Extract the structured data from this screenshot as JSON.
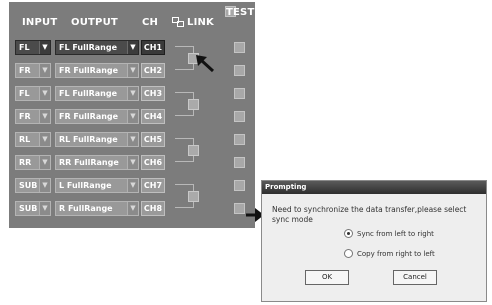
{
  "headers": {
    "input": "INPUT",
    "output": "OUTPUT",
    "ch": "CH",
    "link": "LINK",
    "test": "TEST"
  },
  "rows": [
    {
      "input": "FL",
      "output": "FL FullRange",
      "ch": "CH1"
    },
    {
      "input": "FR",
      "output": "FR FullRange",
      "ch": "CH2"
    },
    {
      "input": "FL",
      "output": "FL FullRange",
      "ch": "CH3"
    },
    {
      "input": "FR",
      "output": "FR FullRange",
      "ch": "CH4"
    },
    {
      "input": "RL",
      "output": "RL FullRange",
      "ch": "CH5"
    },
    {
      "input": "RR",
      "output": "RR FullRange",
      "ch": "CH6"
    },
    {
      "input": "SUB L",
      "output": "L FullRange",
      "ch": "CH7"
    },
    {
      "input": "SUB R",
      "output": "R FullRange",
      "ch": "CH8"
    }
  ],
  "icons": {
    "dropdown": "chevron-down-icon",
    "link": "link-icon",
    "pointer": "arrow-icon"
  },
  "dialog": {
    "title": "Prompting",
    "message": "Need to synchronize the data transfer,please select sync mode",
    "options": [
      "Sync from left to right",
      "Copy from right to left"
    ],
    "selected_option": "Sync from left to right",
    "ok": "OK",
    "cancel": "Cancel"
  },
  "colors": {
    "panel": "#7c7c7c",
    "selected_row": "#3a3a3a",
    "dialog_title": "#2e2e2e"
  }
}
